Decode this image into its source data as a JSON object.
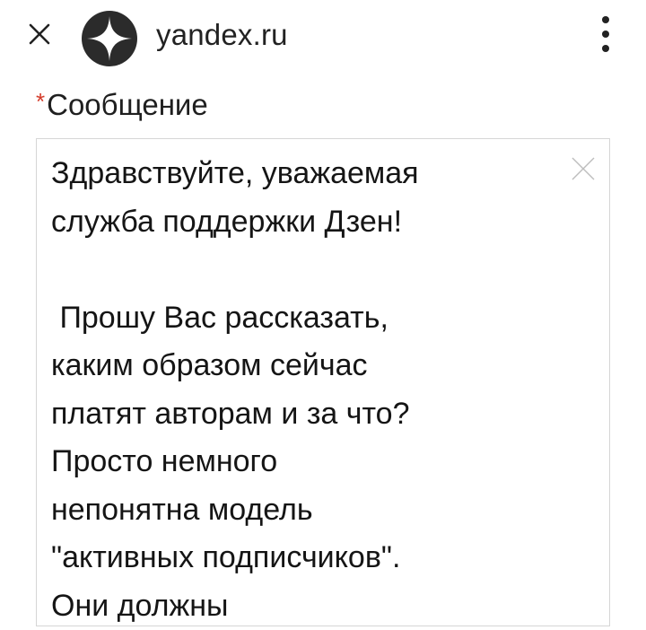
{
  "browser": {
    "close_icon": "close-icon",
    "site_icon": "zen-logo-icon",
    "domain": "yandex.ru",
    "menu_icon": "more-vertical-icon"
  },
  "form": {
    "required_mark": "*",
    "message_label": "Сообщение",
    "message_value": "Здравствуйте, уважаемая\nслужба поддержки Дзен!\n\n Прошу Вас рассказать,\nкаким образом сейчас\nплатят авторам и за что?\nПросто немного\nнепонятна модель\n\"активных подписчиков\".\nОни должны",
    "clear_icon": "clear-icon",
    "required_color": "#d43b2a"
  }
}
